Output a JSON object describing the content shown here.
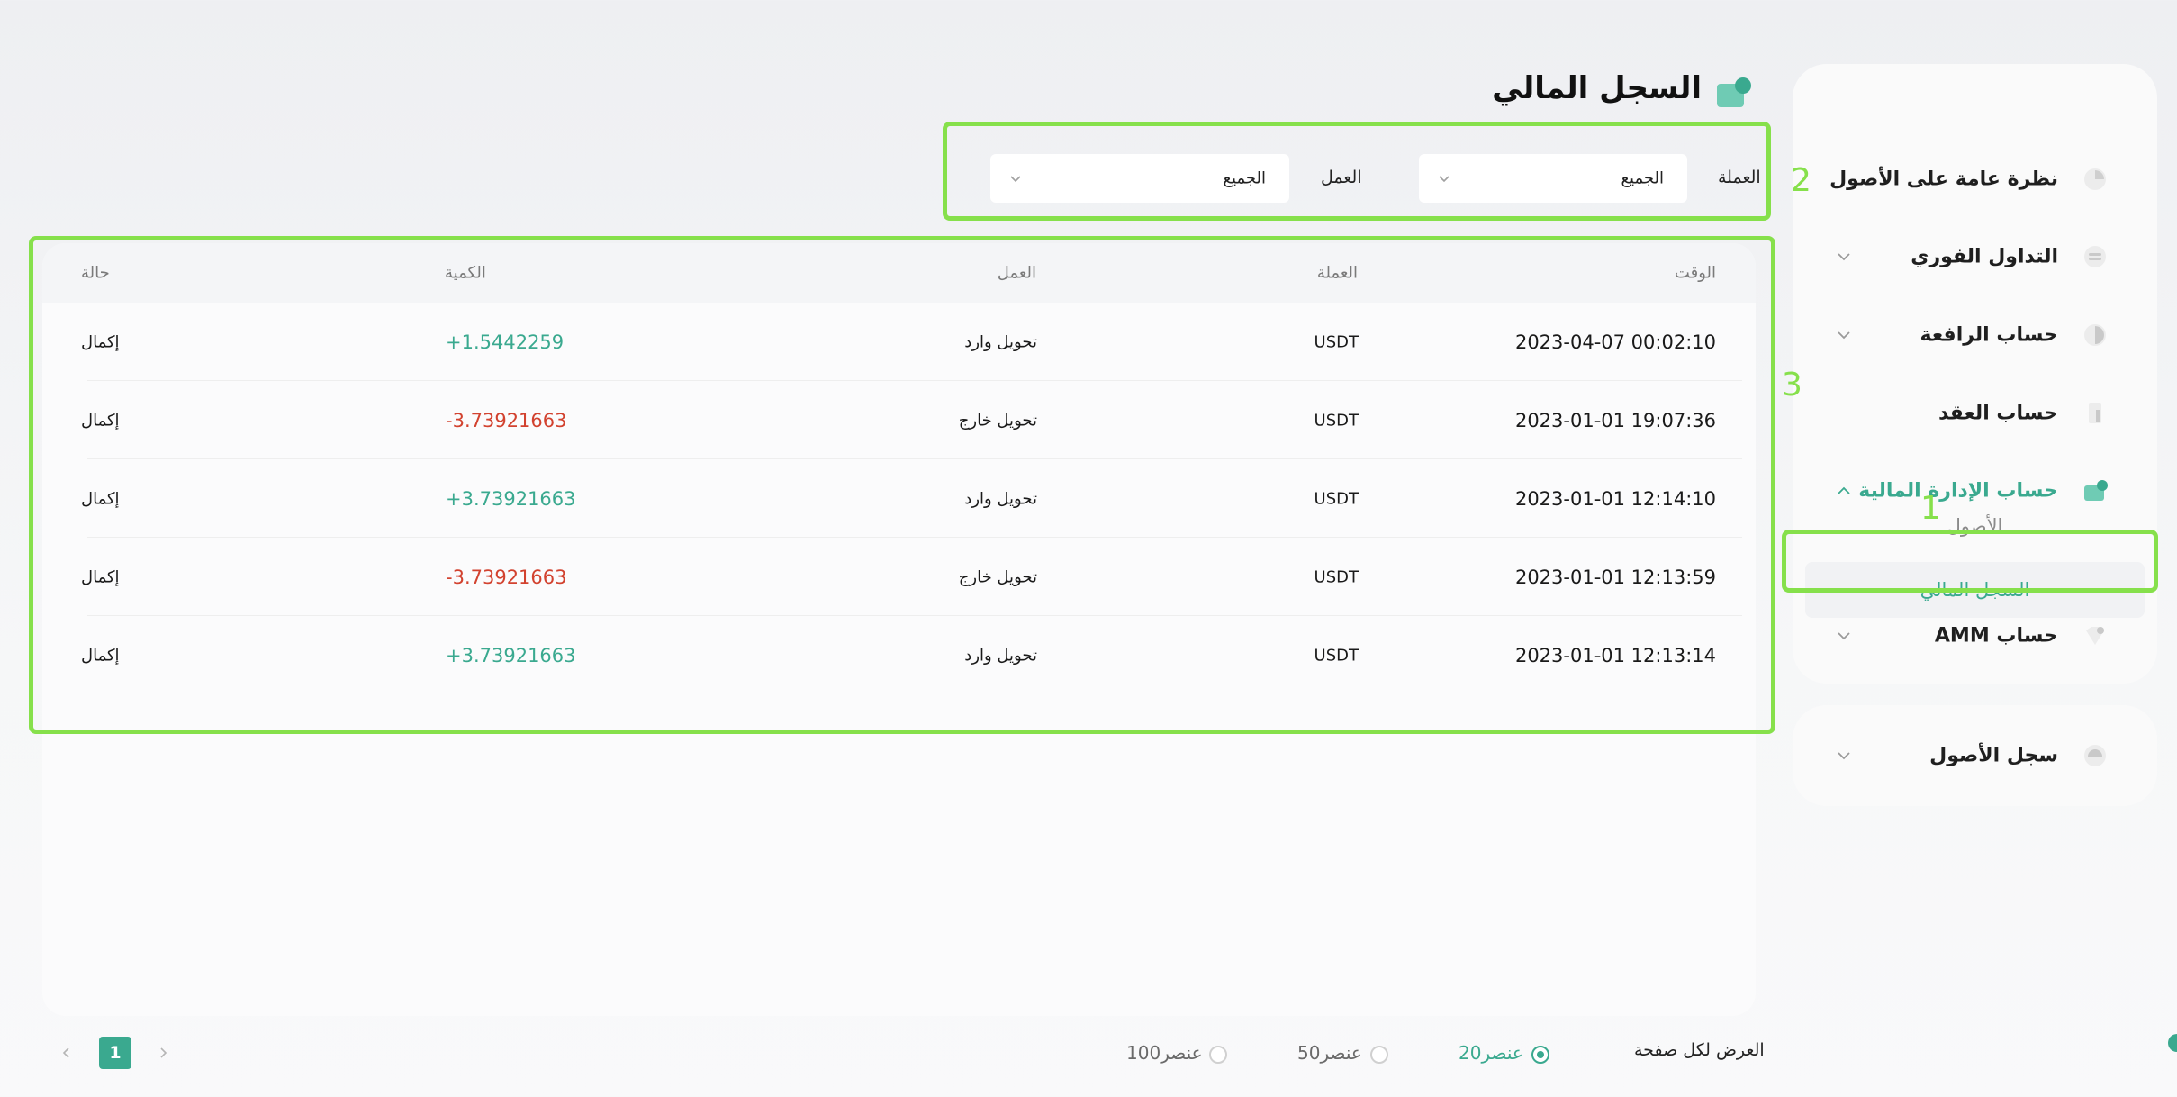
{
  "page": {
    "title": "السجل المالي"
  },
  "sidebar": {
    "items": [
      {
        "label": "نظرة عامة على الأصول",
        "icon": "pie-chart-icon"
      },
      {
        "label": "التداول الفوري",
        "icon": "exchange-icon"
      },
      {
        "label": "حساب الرافعة",
        "icon": "leverage-icon"
      },
      {
        "label": "حساب العقد",
        "icon": "contract-icon"
      },
      {
        "label": "حساب الإدارة المالية",
        "icon": "wallet-icon"
      },
      {
        "label": "حساب AMM",
        "icon": "heart-icon"
      }
    ],
    "sub_items": [
      {
        "label": "الأصول"
      },
      {
        "label": "السجل المالي"
      }
    ],
    "second_card": {
      "label": "سجل الأصول",
      "icon": "history-icon"
    }
  },
  "filters": {
    "currency_label": "العملة",
    "currency_value": "الجميع",
    "action_label": "العمل",
    "action_value": "الجميع"
  },
  "table": {
    "headers": {
      "time": "الوقت",
      "currency": "العملة",
      "action": "العمل",
      "amount": "الكمية",
      "status": "حالة"
    },
    "rows": [
      {
        "time": "2023-04-07 00:02:10",
        "currency": "USDT",
        "action": "تحويل وارد",
        "amount": "+1.5442259",
        "sign": "pos",
        "status": "إكمال"
      },
      {
        "time": "2023-01-01 19:07:36",
        "currency": "USDT",
        "action": "تحويل خارج",
        "amount": "-3.73921663",
        "sign": "neg",
        "status": "إكمال"
      },
      {
        "time": "2023-01-01 12:14:10",
        "currency": "USDT",
        "action": "تحويل وارد",
        "amount": "+3.73921663",
        "sign": "pos",
        "status": "إكمال"
      },
      {
        "time": "2023-01-01 12:13:59",
        "currency": "USDT",
        "action": "تحويل خارج",
        "amount": "-3.73921663",
        "sign": "neg",
        "status": "إكمال"
      },
      {
        "time": "2023-01-01 12:13:14",
        "currency": "USDT",
        "action": "تحويل وارد",
        "amount": "+3.73921663",
        "sign": "pos",
        "status": "إكمال"
      }
    ]
  },
  "pagination": {
    "per_page_label": "العرض لكل صفحة",
    "options": [
      {
        "label": "20عنصر",
        "checked": true
      },
      {
        "label": "50عنصر",
        "checked": false
      },
      {
        "label": "100عنصر",
        "checked": false
      }
    ],
    "current_page": "1"
  },
  "annotations": [
    "1",
    "2",
    "3"
  ],
  "colors": {
    "accent": "#3aa98f",
    "negative": "#d2422f",
    "annotation": "#86e04b"
  }
}
